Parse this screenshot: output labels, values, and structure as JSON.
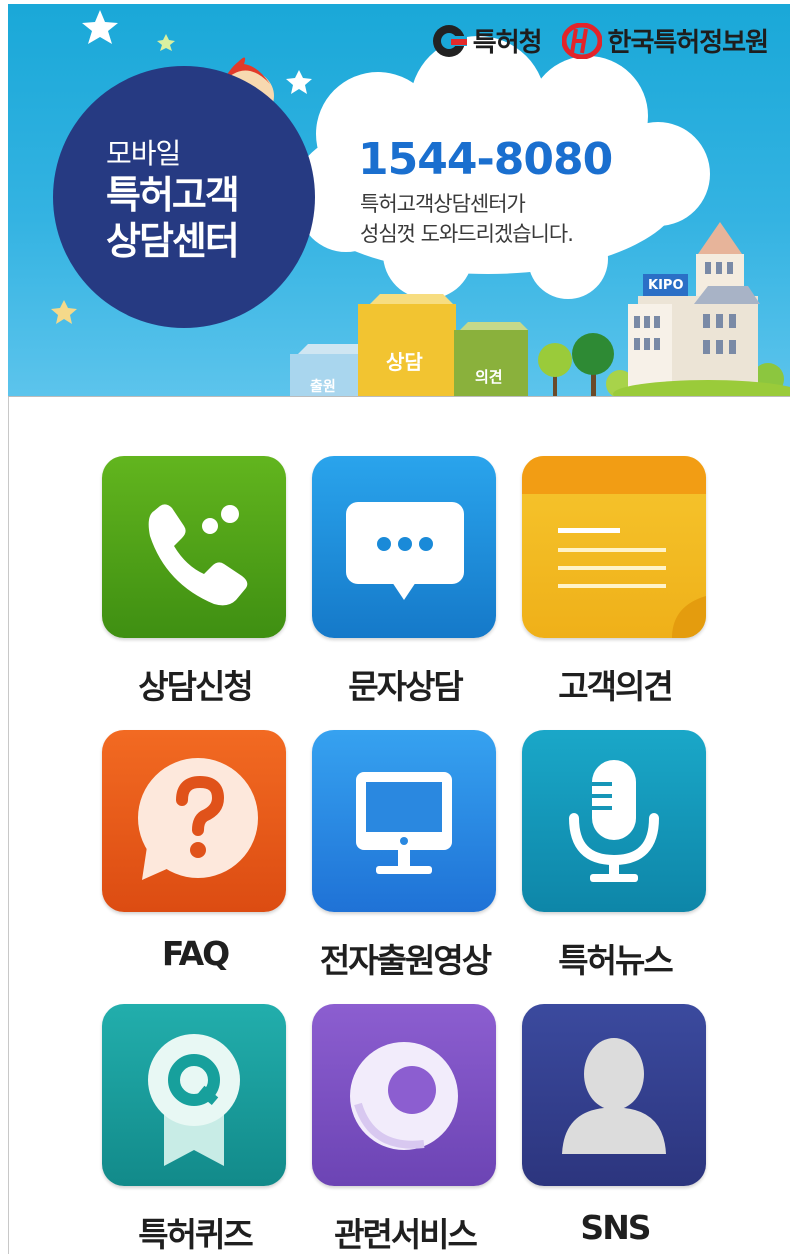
{
  "banner": {
    "org_logo_1": {
      "name": "특허청",
      "icon": "kipo-g-logo-icon"
    },
    "org_logo_2": {
      "name": "한국특허정보원",
      "icon": "kipi-logo-icon"
    },
    "badge_line1": "모바일",
    "badge_line2": "특허고객",
    "badge_line3": "상담센터",
    "phone_number": "1544-8080",
    "desc_line1": "특허고객상담센터가",
    "desc_line2": "성심껏 도와드리겠습니다.",
    "box_labels": [
      "출원",
      "상담",
      "의견"
    ],
    "building_sign": "KIPO"
  },
  "menu": {
    "items": [
      {
        "label": "상담신청",
        "icon": "phone-call-icon",
        "color": "#4aa016"
      },
      {
        "label": "문자상담",
        "icon": "chat-bubble-icon",
        "color": "#1c8fdd"
      },
      {
        "label": "고객의견",
        "icon": "notepad-icon",
        "color": "#f3b91d"
      },
      {
        "label": "FAQ",
        "icon": "question-bubble-icon",
        "color": "#ea5a1e"
      },
      {
        "label": "전자출원영상",
        "icon": "monitor-icon",
        "color": "#2a8de8"
      },
      {
        "label": "특허뉴스",
        "icon": "microphone-icon",
        "color": "#1398b8"
      },
      {
        "label": "특허퀴즈",
        "icon": "quiz-badge-icon",
        "color": "#18a0a0"
      },
      {
        "label": "관련서비스",
        "icon": "ring-icon",
        "color": "#7e52c4"
      },
      {
        "label": "SNS",
        "icon": "person-icon",
        "color": "#36418e"
      }
    ]
  }
}
